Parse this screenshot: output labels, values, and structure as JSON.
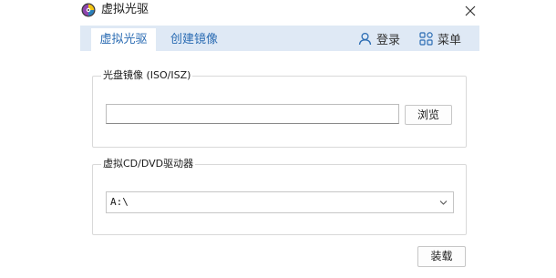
{
  "window": {
    "title": "虚拟光驱"
  },
  "tabs": [
    {
      "label": "虚拟光驱",
      "active": true
    },
    {
      "label": "创建镜像",
      "active": false
    }
  ],
  "nav": {
    "login_label": "登录",
    "menu_label": "菜单"
  },
  "iso_group": {
    "legend": "光盘镜像 (ISO/ISZ)",
    "path_value": "",
    "browse_label": "浏览"
  },
  "drive_group": {
    "legend": "虚拟CD/DVD驱动器",
    "selected_drive": "A:\\"
  },
  "actions": {
    "load_label": "装载"
  },
  "colors": {
    "accent": "#2b6cb3",
    "navbar_bg": "#dfe9f5",
    "border": "#d9d9d9"
  }
}
